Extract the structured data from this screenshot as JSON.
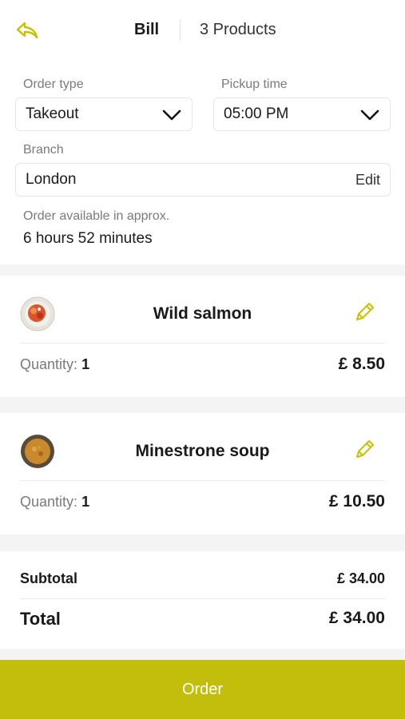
{
  "header": {
    "title": "Bill",
    "product_count": "3 Products"
  },
  "order": {
    "order_type_label": "Order type",
    "order_type_value": "Takeout",
    "pickup_time_label": "Pickup time",
    "pickup_time_value": "05:00 PM",
    "branch_label": "Branch",
    "branch_value": "London",
    "branch_edit": "Edit",
    "available_label": "Order available in approx.",
    "available_value": "6 hours 52 minutes"
  },
  "products": [
    {
      "name": "Wild salmon",
      "quantity_label": "Quantity:",
      "quantity": "1",
      "price": "£ 8.50"
    },
    {
      "name": "Minestrone soup",
      "quantity_label": "Quantity:",
      "quantity": "1",
      "price": "£ 10.50"
    }
  ],
  "summary": {
    "subtotal_label": "Subtotal",
    "subtotal_value": "£ 34.00",
    "total_label": "Total",
    "total_value": "£ 34.00"
  },
  "order_button": "Order",
  "colors": {
    "accent": "#c3be0c",
    "icon": "#c8c000"
  },
  "icons": [
    "reply-back-icon",
    "chevron-down-icon",
    "pencil-edit-icon"
  ]
}
